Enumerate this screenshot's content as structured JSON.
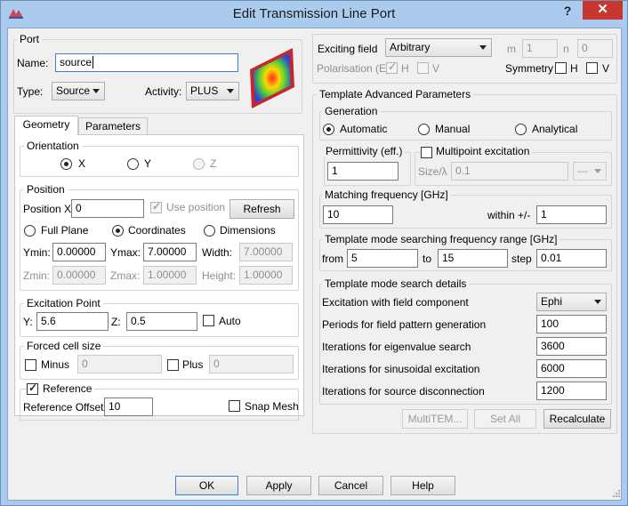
{
  "window": {
    "title": "Edit Transmission Line Port",
    "help": "?",
    "close": "✕"
  },
  "port": {
    "group": "Port",
    "name_label": "Name:",
    "name_value": "source",
    "type_label": "Type:",
    "type_value": "Source",
    "activity_label": "Activity:",
    "activity_value": "PLUS"
  },
  "tabs": [
    "Geometry",
    "Parameters"
  ],
  "orientation": {
    "group": "Orientation",
    "options": [
      "X",
      "Y",
      "Z"
    ],
    "selected": "X"
  },
  "position": {
    "group": "Position",
    "pos_x_label": "Position X",
    "pos_x_value": "0",
    "use_position_label": "Use position",
    "refresh_label": "Refresh",
    "mode_options": [
      "Full Plane",
      "Coordinates",
      "Dimensions"
    ],
    "mode_selected": "Coordinates",
    "ymin_label": "Ymin:",
    "ymin_value": "0.00000",
    "ymax_label": "Ymax:",
    "ymax_value": "7.00000",
    "width_label": "Width:",
    "width_value": "7.00000",
    "zmin_label": "Zmin:",
    "zmin_value": "0.00000",
    "zmax_label": "Zmax:",
    "zmax_value": "1.00000",
    "height_label": "Height:",
    "height_value": "1.00000"
  },
  "excitation_point": {
    "group": "Excitation Point",
    "y_label": "Y:",
    "y_value": "5.6",
    "z_label": "Z:",
    "z_value": "0.5",
    "auto_label": "Auto"
  },
  "forced_cell": {
    "group": "Forced cell size",
    "minus_label": "Minus",
    "minus_value": "0",
    "plus_label": "Plus",
    "plus_value": "0"
  },
  "reference": {
    "label": "Reference",
    "offset_label": "Reference Offset",
    "offset_value": "10",
    "snap_mesh_label": "Snap Mesh"
  },
  "exciting": {
    "field_label": "Exciting field",
    "field_value": "Arbitrary",
    "m_label": "m",
    "m_value": "1",
    "n_label": "n",
    "n_value": "0",
    "polarisation_label": "Polarisation (E)",
    "pol_h": "H",
    "pol_v": "V",
    "symmetry_label": "Symmetry",
    "sym_h": "H",
    "sym_v": "V"
  },
  "template": {
    "group": "Template Advanced Parameters",
    "generation_group": "Generation",
    "generation_options": [
      "Automatic",
      "Manual",
      "Analytical"
    ],
    "generation_selected": "Automatic",
    "permittivity_label": "Permittivity (eff.)",
    "permittivity_value": "1",
    "multipoint_label": "Multipoint excitation",
    "size_label": "Size/λ",
    "size_value": "0.1",
    "size_unit": "---",
    "matching_group": "Matching frequency [GHz]",
    "matching_value": "10",
    "within_label": "within +/-",
    "within_value": "1",
    "range_group": "Template mode searching frequency range [GHz]",
    "from_label": "from",
    "from_value": "5",
    "to_label": "to",
    "to_value": "15",
    "step_label": "step",
    "step_value": "0.01",
    "details_group": "Template mode search details",
    "field_component_label": "Excitation with field component",
    "field_component_value": "Ephi",
    "periods_label": "Periods for field pattern generation",
    "periods_value": "100",
    "eigen_label": "Iterations for eigenvalue search",
    "eigen_value": "3600",
    "sinus_label": "Iterations for sinusoidal excitation",
    "sinus_value": "6000",
    "disconnect_label": "Iterations for source disconnection",
    "disconnect_value": "1200",
    "multitem_label": "MultiTEM...",
    "setall_label": "Set All",
    "recalc_label": "Recalculate"
  },
  "footer": {
    "ok": "OK",
    "apply": "Apply",
    "cancel": "Cancel",
    "help": "Help"
  }
}
